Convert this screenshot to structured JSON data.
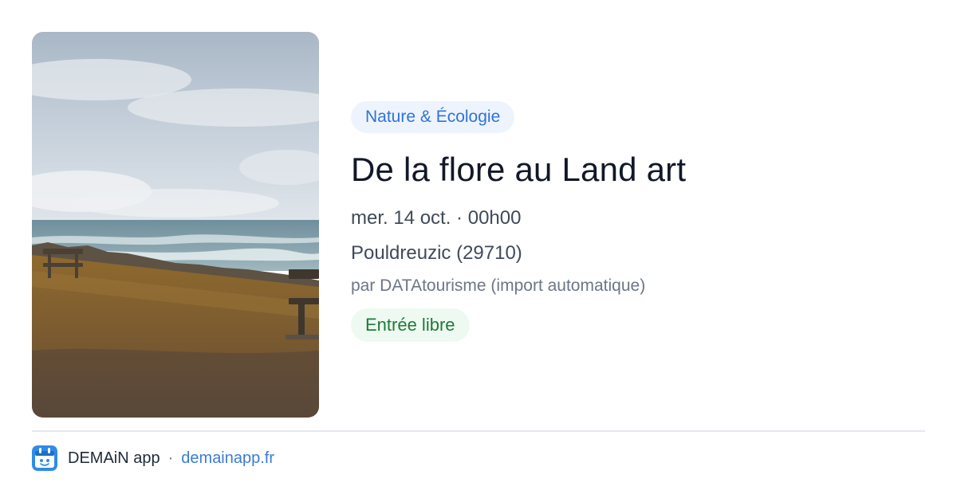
{
  "event": {
    "category": "Nature & Écologie",
    "title": "De la flore au Land art",
    "datetime": "mer. 14 oct. · 00h00",
    "location": "Pouldreuzic (29710)",
    "organizer": "par DATAtourisme (import automatique)",
    "price": "Entrée libre"
  },
  "footer": {
    "app_name": "DEMAiN app",
    "separator": "·",
    "url": "demainapp.fr"
  },
  "icons": {
    "app_icon": "demain-app-icon"
  },
  "colors": {
    "category_badge_bg": "#eef4fd",
    "category_badge_text": "#2f73d9",
    "price_badge_bg": "#eefaf1",
    "price_badge_text": "#1f7a3a",
    "link": "#3a7bd5",
    "app_icon_blue": "#2e8ce6"
  }
}
